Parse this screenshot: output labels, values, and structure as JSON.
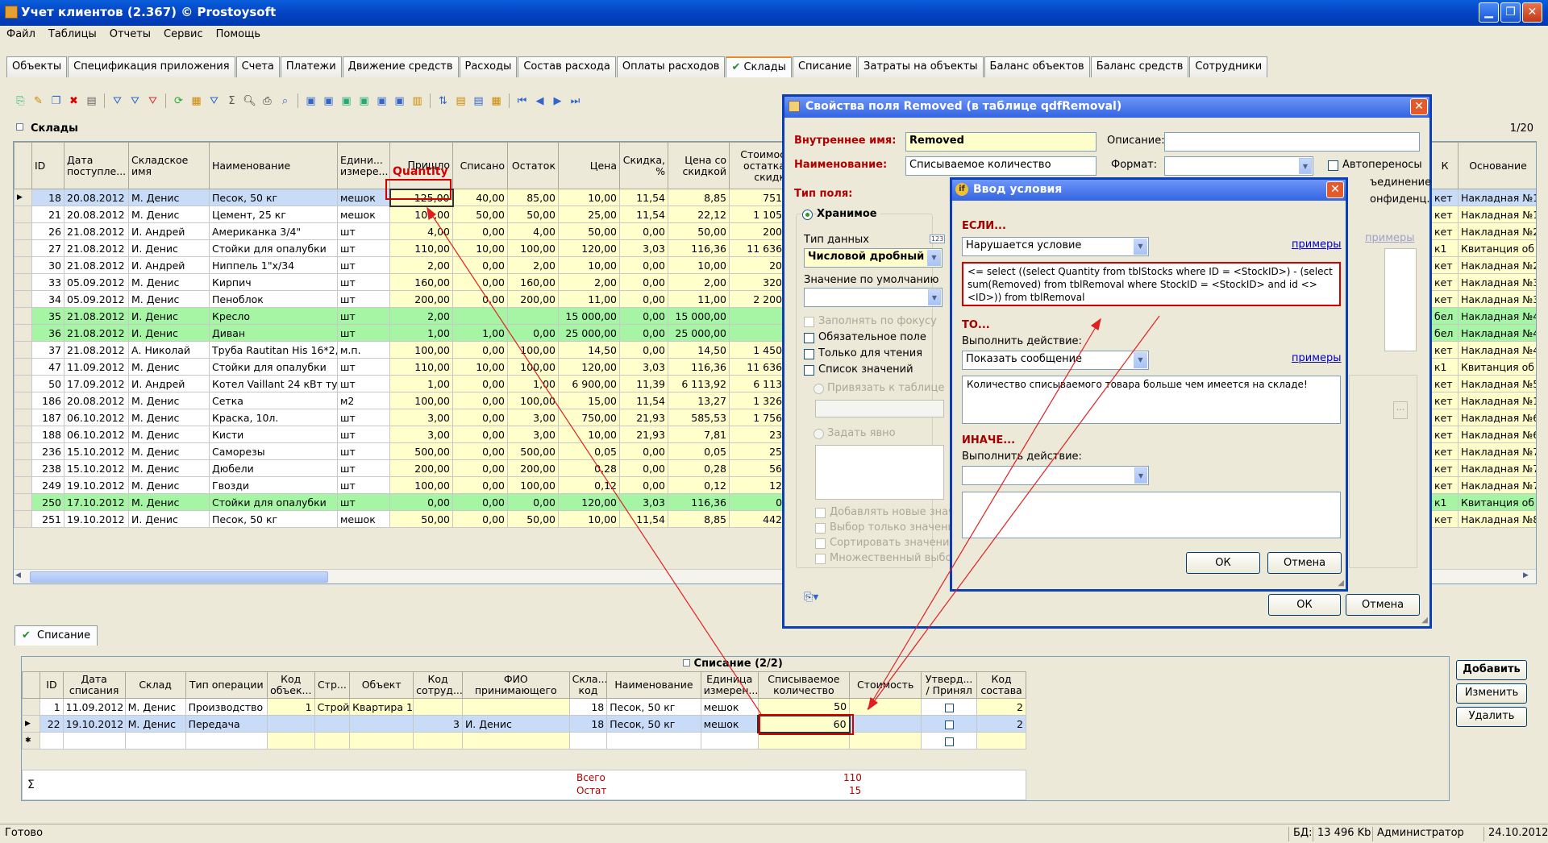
{
  "window": {
    "title": "Учет клиентов (2.367) © Prostoysoft"
  },
  "menu": [
    "Файл",
    "Таблицы",
    "Отчеты",
    "Сервис",
    "Помощь"
  ],
  "tabs": [
    "Объекты",
    "Спецификация приложения",
    "Счета",
    "Платежи",
    "Движение средств",
    "Расходы",
    "Состав расхода",
    "Оплаты расходов",
    "Склады",
    "Списание",
    "Затраты на объекты",
    "Баланс объектов",
    "Баланс средств",
    "Сотрудники"
  ],
  "active_tab": "Склады",
  "panel": {
    "title": "Склады",
    "page": "1/20"
  },
  "stock_headers": [
    "ID",
    "Дата поступле...",
    "Складское имя",
    "Наименование",
    "Едини... измере...",
    "Пришло",
    "Списано",
    "Остаток",
    "Цена",
    "Скидка, %",
    "Цена со скидкой",
    "Стоимос остатка скидк"
  ],
  "right_headers": [
    "К",
    "Основание"
  ],
  "annotation": "Quantity",
  "stock_rows": [
    [
      "18",
      "20.08.2012",
      "М. Денис",
      "Песок, 50 кг",
      "мешок",
      "125,00",
      "40,00",
      "85,00",
      "10,00",
      "11,54",
      "8,85",
      "751,"
    ],
    [
      "21",
      "20.08.2012",
      "М. Денис",
      "Цемент, 25 кг",
      "мешок",
      "100,00",
      "50,00",
      "50,00",
      "25,00",
      "11,54",
      "22,12",
      "1 105,"
    ],
    [
      "26",
      "21.08.2012",
      "И. Андрей",
      "Американка 3/4\"",
      "шт",
      "4,00",
      "0,00",
      "4,00",
      "50,00",
      "0,00",
      "50,00",
      "200,"
    ],
    [
      "27",
      "21.08.2012",
      "И. Денис",
      "Стойки для опалубки",
      "шт",
      "110,00",
      "10,00",
      "100,00",
      "120,00",
      "3,03",
      "116,36",
      "11 636,"
    ],
    [
      "30",
      "21.08.2012",
      "И. Андрей",
      "Ниппель 1\"х/34",
      "шт",
      "2,00",
      "0,00",
      "2,00",
      "10,00",
      "0,00",
      "10,00",
      "20,"
    ],
    [
      "33",
      "05.09.2012",
      "М. Денис",
      "Кирпич",
      "шт",
      "160,00",
      "0,00",
      "160,00",
      "2,00",
      "0,00",
      "2,00",
      "320,"
    ],
    [
      "34",
      "05.09.2012",
      "М. Денис",
      "Пеноблок",
      "шт",
      "200,00",
      "0,00",
      "200,00",
      "11,00",
      "0,00",
      "11,00",
      "2 200,"
    ],
    [
      "35",
      "21.08.2012",
      "И. Денис",
      "Кресло",
      "шт",
      "2,00",
      "",
      "",
      "15 000,00",
      "0,00",
      "15 000,00",
      ""
    ],
    [
      "36",
      "21.08.2012",
      "И. Денис",
      "Диван",
      "шт",
      "1,00",
      "1,00",
      "0,00",
      "25 000,00",
      "0,00",
      "25 000,00",
      ""
    ],
    [
      "37",
      "21.08.2012",
      "А. Николай",
      "Труба Rautitan His 16*2,2",
      "м.п.",
      "100,00",
      "0,00",
      "100,00",
      "14,50",
      "0,00",
      "14,50",
      "1 450,"
    ],
    [
      "47",
      "11.09.2012",
      "М. Денис",
      "Стойки для опалубки",
      "шт",
      "110,00",
      "10,00",
      "100,00",
      "120,00",
      "3,03",
      "116,36",
      "11 636,"
    ],
    [
      "50",
      "17.09.2012",
      "И. Андрей",
      "Котел Vaillant 24 кВт турбо",
      "шт",
      "1,00",
      "0,00",
      "1,00",
      "6 900,00",
      "11,39",
      "6 113,92",
      "6 113,"
    ],
    [
      "186",
      "20.08.2012",
      "М. Денис",
      "Сетка",
      "м2",
      "100,00",
      "0,00",
      "100,00",
      "15,00",
      "11,54",
      "13,27",
      "1 326,"
    ],
    [
      "187",
      "06.10.2012",
      "М. Денис",
      "Краска, 10л.",
      "шт",
      "3,00",
      "0,00",
      "3,00",
      "750,00",
      "21,93",
      "585,53",
      "1 756,"
    ],
    [
      "188",
      "06.10.2012",
      "М. Денис",
      "Кисти",
      "шт",
      "3,00",
      "0,00",
      "3,00",
      "10,00",
      "21,93",
      "7,81",
      "23,"
    ],
    [
      "236",
      "15.10.2012",
      "М. Денис",
      "Саморезы",
      "шт",
      "500,00",
      "0,00",
      "500,00",
      "0,05",
      "0,00",
      "0,05",
      "25,"
    ],
    [
      "238",
      "15.10.2012",
      "М. Денис",
      "Дюбели",
      "шт",
      "200,00",
      "0,00",
      "200,00",
      "0,28",
      "0,00",
      "0,28",
      "56,"
    ],
    [
      "249",
      "19.10.2012",
      "М. Денис",
      "Гвозди",
      "шт",
      "100,00",
      "0,00",
      "100,00",
      "0,12",
      "0,00",
      "0,12",
      "12,"
    ],
    [
      "250",
      "17.10.2012",
      "М. Денис",
      "Стойки для опалубки",
      "шт",
      "0,00",
      "0,00",
      "0,00",
      "120,00",
      "3,03",
      "116,36",
      "0,"
    ],
    [
      "251",
      "19.10.2012",
      "И. Денис",
      "Песок, 50 кг",
      "мешок",
      "50,00",
      "0,00",
      "50,00",
      "10,00",
      "11,54",
      "8,85",
      "442,"
    ]
  ],
  "right_rows": [
    [
      "кет",
      "Накладная №1"
    ],
    [
      "кет",
      "Накладная №1"
    ],
    [
      "кет",
      "Накладная №2"
    ],
    [
      "к1",
      "Квитанция об о"
    ],
    [
      "кет",
      "Накладная №2"
    ],
    [
      "кет",
      "Накладная №3"
    ],
    [
      "кет",
      "Накладная №3"
    ],
    [
      "бел",
      "Накладная №4"
    ],
    [
      "бел",
      "Накладная №4"
    ],
    [
      "кет",
      "Накладная №4"
    ],
    [
      "к1",
      "Квитанция об о"
    ],
    [
      "кет",
      "Накладная №5"
    ],
    [
      "кет",
      "Накладная №1"
    ],
    [
      "кет",
      "Накладная №6"
    ],
    [
      "кет",
      "Накладная №6"
    ],
    [
      "кет",
      "Накладная №7"
    ],
    [
      "кет",
      "Накладная №7"
    ],
    [
      "кет",
      "Накладная №7"
    ],
    [
      "к1",
      "Квитанция об о"
    ],
    [
      "кет",
      "Накладная №8"
    ]
  ],
  "bottom_tab": "Списание",
  "bottom_title": "Списание (2/2)",
  "bottom_headers": [
    "ID",
    "Дата списания",
    "Склад",
    "Тип операции",
    "Код объек...",
    "Стр...",
    "Объект",
    "Код сотруд...",
    "ФИО принимающего",
    "Скла... код",
    "Наименование",
    "Единица измерен...",
    "Списываемое количество",
    "Стоимость",
    "Утверд... / Принял",
    "Код состава"
  ],
  "bottom_rows": [
    [
      "1",
      "11.09.2012",
      "М. Денис",
      "Производство",
      "1",
      "Строй",
      "Квартира 1",
      "",
      "",
      "18",
      "Песок, 50 кг",
      "мешок",
      "50",
      "",
      "",
      "2"
    ],
    [
      "22",
      "19.10.2012",
      "М. Денис",
      "Передача",
      "",
      "",
      "",
      "3",
      "И. Денис",
      "18",
      "Песок, 50 кг",
      "мешок",
      "60",
      "",
      "",
      "2"
    ]
  ],
  "totals": {
    "sigma": "Σ",
    "l1": "Всего",
    "l2": "Остат",
    "v1": "110",
    "v2": "15"
  },
  "side_buttons": [
    "Добавить",
    "Изменить",
    "Удалить"
  ],
  "props": {
    "title": "Свойства поля Removed (в таблице qdfRemoval)",
    "internal_label": "Внутреннее имя:",
    "internal_value": "Removed",
    "name_label": "Наименование:",
    "name_value": "Списываемое количество",
    "desc_label": "Описание:",
    "format_label": "Формат:",
    "autowrap": "Автопереносы",
    "join": "ъединение",
    "conf": "онфиденц.",
    "type_label": "Тип поля:",
    "stored": "Хранимое",
    "datatype_label": "Тип данных",
    "datatype_value": "Числовой дробный",
    "default_label": "Значение по умолчанию",
    "checks": [
      "Заполнять по фокусу",
      "Обязательное поле",
      "Только для чтения",
      "Список значений"
    ],
    "bind_table": "Привязать к таблице",
    "explicit": "Задать явно",
    "checks2": [
      "Добавлять новые значения",
      "Выбор только значения",
      "Сортировать значения",
      "Множественный выбор"
    ],
    "examples": "примеры",
    "badge": "123",
    "ok": "ОК",
    "cancel": "Отмена"
  },
  "cond": {
    "title": "Ввод условия",
    "if": "ЕСЛИ...",
    "if_value": "Нарушается условие",
    "expr": "<=  select ((select Quantity from tblStocks where ID = <StockID>) - (select sum(Removed) from tblRemoval where StockID = <StockID> and id <> <ID>)) from tblRemoval",
    "then": "ТО...",
    "do_label": "Выполнить действие:",
    "do_value": "Показать сообщение",
    "msg": "Количество списываемого товара больше чем имеется на складе!",
    "else": "ИНАЧЕ...",
    "else_do": "Выполнить действие:",
    "examples": "примеры",
    "ok": "ОК",
    "cancel": "Отмена",
    "side": [
      "не",
      "ице",
      "цы"
    ]
  },
  "status": {
    "ready": "Готово",
    "db": "БД:",
    "size": "13 496 Kb",
    "user": "Администратор",
    "date": "24.10.2012"
  },
  "colors": {
    "title": "#0446c6",
    "yellow": "#ffffcc",
    "green": "#a5f5a5",
    "selected": "#c8dcf8",
    "annotation": "#d40000"
  }
}
